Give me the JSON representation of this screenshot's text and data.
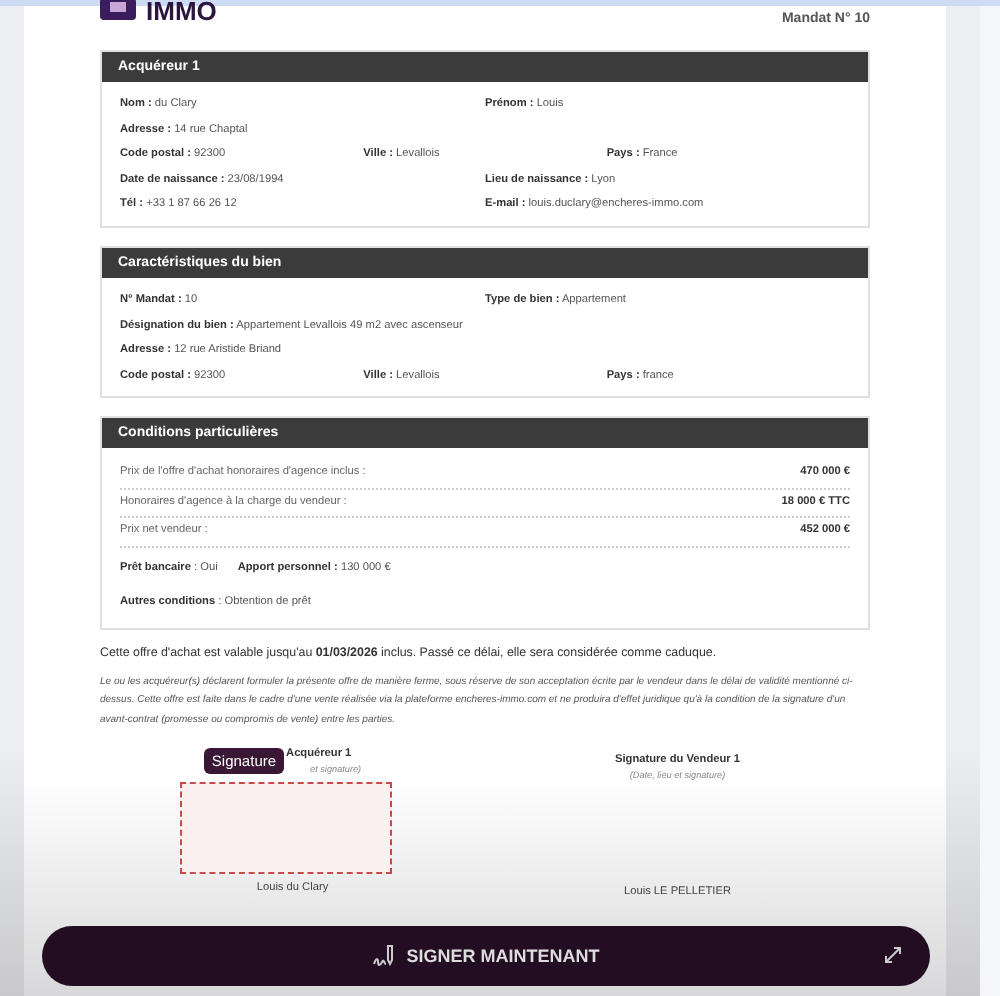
{
  "header": {
    "logo_text": "IMMO",
    "mandate": "Mandat N° 10"
  },
  "sections": [
    {
      "title": "Acquéreur 1",
      "kind": "fields",
      "rows": [
        [
          {
            "label": "Nom :",
            "value": "du Clary"
          },
          {
            "label": "Prénom :",
            "value": "Louis"
          }
        ],
        [
          {
            "label": "Adresse :",
            "value": "14 rue Chaptal"
          }
        ],
        [
          {
            "label": "Code postal :",
            "value": "92300"
          },
          {
            "label": "Ville :",
            "value": "Levallois"
          },
          {
            "label": "Pays :",
            "value": "France"
          }
        ],
        [
          {
            "label": "Date de naissance :",
            "value": "23/08/1994"
          },
          {
            "label": "Lieu de naissance :",
            "value": "Lyon"
          }
        ],
        [
          {
            "label": "Tél :",
            "value": "+33 1 87 66 26 12"
          },
          {
            "label": "E-mail :",
            "value": "louis.duclary@encheres-immo.com"
          }
        ]
      ]
    },
    {
      "title": "Caractéristiques du bien",
      "kind": "fields",
      "rows": [
        [
          {
            "label": "N° Mandat :",
            "value": "10"
          },
          {
            "label": "Type de bien :",
            "value": "Appartement"
          }
        ],
        [
          {
            "label": "Désignation du bien :",
            "value": "Appartement Levallois 49 m2 avec ascenseur"
          }
        ],
        [
          {
            "label": "Adresse :",
            "value": "12 rue Aristide Briand"
          }
        ],
        [
          {
            "label": "Code postal :",
            "value": "92300"
          },
          {
            "label": "Ville :",
            "value": "Levallois"
          },
          {
            "label": "Pays :",
            "value": "france"
          }
        ]
      ]
    },
    {
      "title": "Conditions particulières",
      "kind": "conditions",
      "prices": [
        {
          "label": "Prix de l'offre d'achat honoraires d'agence inclus :",
          "value": "470 000 €"
        },
        {
          "label": "Honoraires d'agence à la charge du vendeur :",
          "value": "18 000 € TTC"
        },
        {
          "label": "Prix net vendeur :",
          "value": "452 000 €"
        }
      ],
      "rows": [
        [
          {
            "label": "Prêt bancaire",
            "value": ": Oui"
          },
          {
            "label": "Apport personnel :",
            "value": "130 000 €"
          }
        ],
        [
          {
            "label": "Autres conditions",
            "value": ": Obtention de prêt"
          }
        ]
      ]
    }
  ],
  "validity": "Cette offre d'achat est valable jusqu'au **01/03/2026** inclus. Passé ce délai, elle sera considérée comme caduque.",
  "legal": "Le ou les acquéreur(s) déclarent formuler la présente offre de manière ferme, sous réserve de son acceptation écrite par le vendeur dans le délai de validité mentionné ci-dessus. Cette offre est faite dans le cadre d'une vente réalisée via la plateforme encheres-immo.com et ne produira d'effet juridique qu'à la condition de la signature d'un avant-contrat (promesse ou compromis de vente) entre les parties.",
  "signatures": [
    {
      "kind": "buyer",
      "badge": "Signature",
      "title": "Acquéreur 1",
      "subtitle": "et signature)",
      "name": "Louis du Clary"
    },
    {
      "kind": "seller",
      "title": "Signature du Vendeur 1",
      "subtitle": "(Date, lieu et signature)",
      "name": "Louis LE PELLETIER"
    }
  ],
  "action_button": {
    "label": "SIGNER MAINTENANT"
  }
}
